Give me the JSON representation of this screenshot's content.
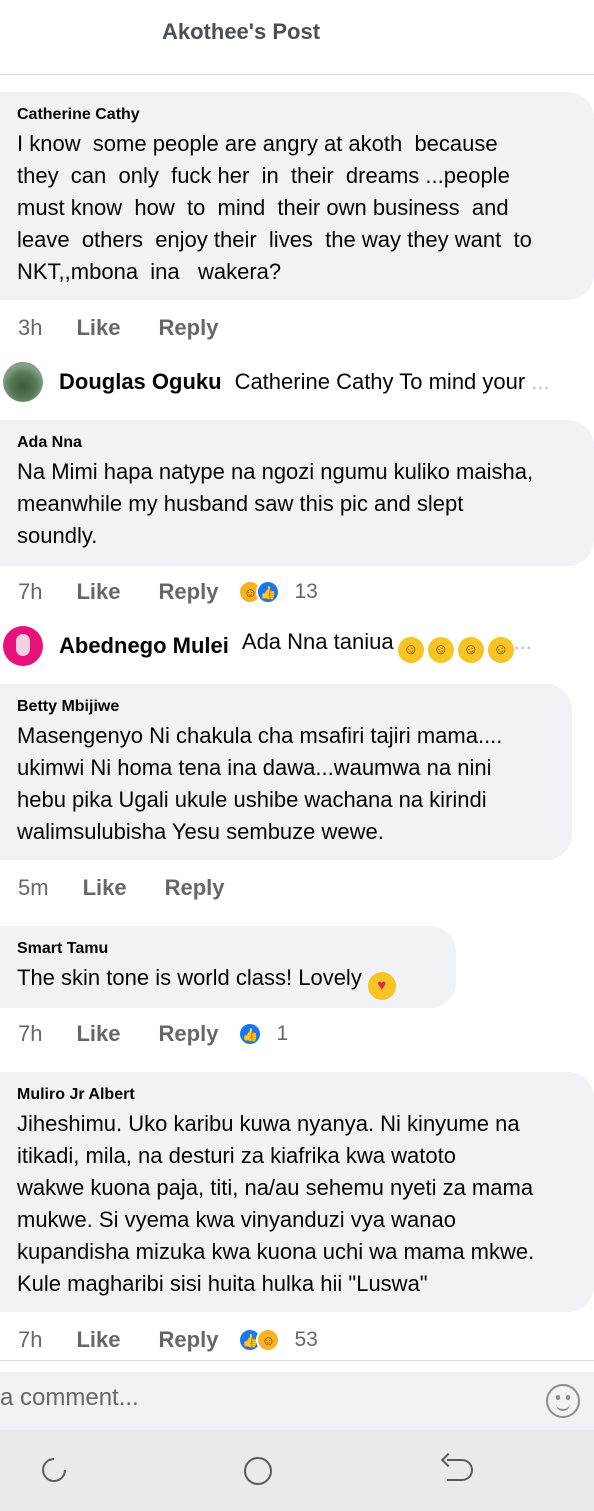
{
  "header": {
    "title": "Akothee's Post"
  },
  "comments": [
    {
      "author": "Catherine Cathy",
      "text": "I know  some people are angry at akoth  because\nthey  can  only  fuck her  in  their  dreams ...people\nmust know  how  to  mind  their own business  and\nleave  others  enjoy their  lives  the way they want  to\nNKT,,mbona  ina   wakera?",
      "time": "3h",
      "like": "Like",
      "reply": "Reply"
    },
    {
      "author": "Ada Nna",
      "text": "Na Mimi hapa natype na ngozi ngumu kuliko maisha,\nmeanwhile my husband saw this pic and slept\nsoundly.",
      "time": "7h",
      "like": "Like",
      "reply": "Reply",
      "reactions": [
        "haha-icon",
        "like-icon"
      ],
      "reaction_count": "13"
    },
    {
      "author": "Betty Mbijiwe",
      "text": "Masengenyo Ni chakula cha msafiri tajiri mama....\nukimwi Ni homa tena ina dawa...waumwa na nini\nhebu pika Ugali ukule ushibe wachana na kirindi\nwalimsulubisha Yesu sembuze wewe.",
      "time": "5m",
      "like": "Like",
      "reply": "Reply"
    },
    {
      "author": "Smart Tamu",
      "text": "The skin tone is world class! Lovely",
      "time": "7h",
      "like": "Like",
      "reply": "Reply",
      "reactions": [
        "like-icon"
      ],
      "reaction_count": "1"
    },
    {
      "author": "Muliro Jr Albert",
      "text": "Jiheshimu. Uko karibu kuwa nyanya. Ni kinyume na\nitikadi, mila, na desturi za kiafrika kwa watoto\nwakwe kuona paja, titi, na/au sehemu nyeti za mama\nmukwe. Si vyema kwa vinyanduzi vya wanao\nkupandisha mizuka kwa kuona uchi wa mama mkwe.\nKule magharibi sisi huita hulka hii \"Luswa\"",
      "time": "7h",
      "like": "Like",
      "reply": "Reply",
      "reactions": [
        "like-icon",
        "haha-icon"
      ],
      "reaction_count": "53"
    }
  ],
  "replies": [
    {
      "author": "Douglas Oguku",
      "text": "Catherine Cathy To mind your",
      "ellipsis": "..."
    },
    {
      "author": "Abednego Mulei",
      "text": "Ada Nna taniua",
      "ellipsis": "..."
    }
  ],
  "composer": {
    "placeholder": "a comment..."
  },
  "colors": {
    "bubble": "#f0f2f5",
    "like_blue": "#1877f2",
    "muted": "#65676b"
  }
}
